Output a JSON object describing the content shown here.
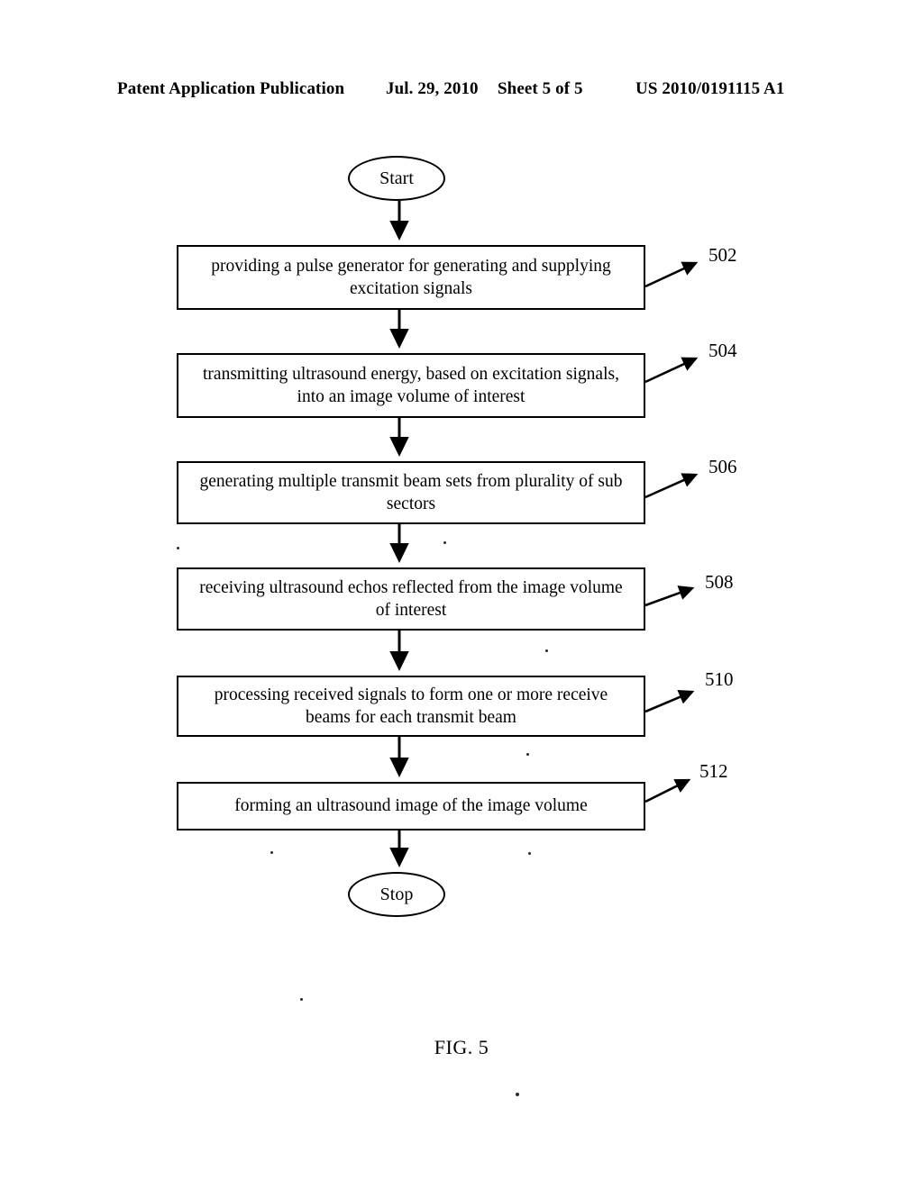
{
  "header": {
    "publication": "Patent Application Publication",
    "date": "Jul. 29, 2010",
    "sheet": "Sheet 5 of 5",
    "patent_number": "US 2010/0191115 A1"
  },
  "figure": {
    "caption": "FIG. 5",
    "type": "flowchart",
    "nodes": [
      {
        "id": "start",
        "shape": "oval",
        "label": "Start"
      },
      {
        "id": "502",
        "shape": "rect",
        "ref": "502",
        "label": "providing a pulse generator for generating and supplying excitation signals"
      },
      {
        "id": "504",
        "shape": "rect",
        "ref": "504",
        "label": "transmitting ultrasound energy, based on excitation signals, into an image volume of interest"
      },
      {
        "id": "506",
        "shape": "rect",
        "ref": "506",
        "label": "generating multiple transmit beam sets from plurality of sub sectors"
      },
      {
        "id": "508",
        "shape": "rect",
        "ref": "508",
        "label": "receiving ultrasound echos reflected from the image volume of interest"
      },
      {
        "id": "510",
        "shape": "rect",
        "ref": "510",
        "label": "processing received signals to form one or more receive beams for each transmit beam"
      },
      {
        "id": "512",
        "shape": "rect",
        "ref": "512",
        "label": "forming an ultrasound image of the image volume"
      },
      {
        "id": "stop",
        "shape": "oval",
        "label": "Stop"
      }
    ],
    "edges": [
      {
        "from": "start",
        "to": "502"
      },
      {
        "from": "502",
        "to": "504"
      },
      {
        "from": "504",
        "to": "506"
      },
      {
        "from": "506",
        "to": "508"
      },
      {
        "from": "508",
        "to": "510"
      },
      {
        "from": "510",
        "to": "512"
      },
      {
        "from": "512",
        "to": "stop"
      }
    ]
  },
  "colors": {
    "ink": "#000000",
    "paper": "#ffffff"
  }
}
